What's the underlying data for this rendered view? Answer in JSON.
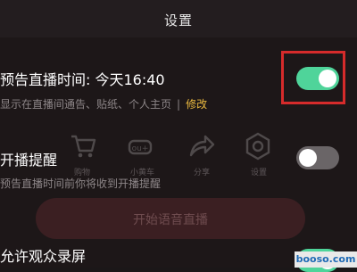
{
  "header": {
    "title": "设置"
  },
  "settings": [
    {
      "label": "预告直播时间: 今天16:40",
      "desc": "显示在直播间通告、贴纸、个人主页",
      "separator": "|",
      "link": "修改",
      "toggle": "on"
    },
    {
      "label": "开播提醒",
      "desc": "预告直播时间前你将收到开播提醒",
      "toggle": "off"
    },
    {
      "label": "允许观众录屏",
      "toggle": "on"
    }
  ],
  "background": {
    "icons": [
      {
        "name": "cart-icon",
        "label": "购物"
      },
      {
        "name": "bag-icon",
        "label": "小黄车"
      },
      {
        "name": "share-icon",
        "label": "分享"
      },
      {
        "name": "settings-icon",
        "label": "设置"
      }
    ],
    "button_label": "开始语音直播"
  },
  "watermark": {
    "text": "booso.com"
  },
  "colors": {
    "toggle_on": "#4fd49a",
    "toggle_off": "#6a6567",
    "link": "#e9b83f",
    "highlight": "#d62b2b"
  }
}
